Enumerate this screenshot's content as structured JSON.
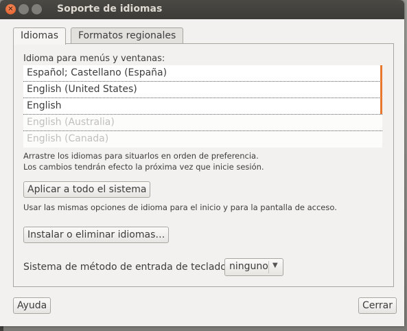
{
  "window": {
    "title": "Soporte de idiomas"
  },
  "tabs": [
    {
      "label": "Idiomas",
      "active": true
    },
    {
      "label": "Formatos regionales",
      "active": false
    }
  ],
  "languages_section": {
    "heading": "Idioma para menús y ventanas:",
    "items": [
      {
        "label": "Español; Castellano (España)",
        "enabled": true
      },
      {
        "label": "English (United States)",
        "enabled": true
      },
      {
        "label": "English",
        "enabled": true
      },
      {
        "label": "English (Australia)",
        "enabled": false
      },
      {
        "label": "English (Canada)",
        "enabled": false
      }
    ],
    "hint_line1": "Arrastre los idiomas para situarlos en orden de preferencia.",
    "hint_line2": "Los cambios tendrán efecto la próxima vez que inicie sesión."
  },
  "apply_button": "Aplicar a todo el sistema",
  "apply_hint": "Usar las mismas opciones de idioma para el inicio y para la pantalla de acceso.",
  "install_button": "Instalar o eliminar idiomas…",
  "input_method": {
    "label": "Sistema de método de entrada de teclado:",
    "value": "ninguno"
  },
  "help_button": "Ayuda",
  "close_button": "Cerrar",
  "colors": {
    "accent": "#e9782e",
    "titlebar": "#3c3b37"
  }
}
